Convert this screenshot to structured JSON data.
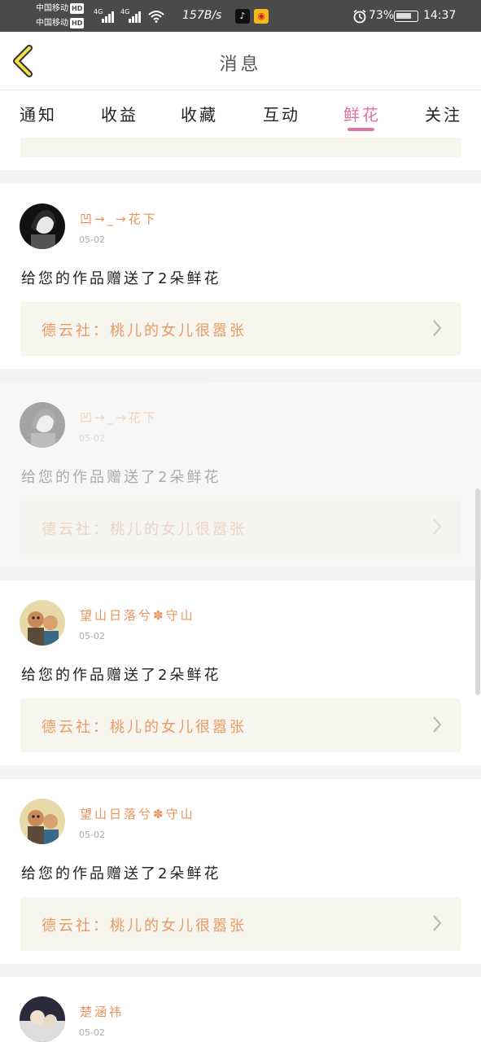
{
  "status_bar": {
    "carrier1": "中国移动",
    "carrier2": "中国移动",
    "hd": "HD",
    "net1": "4G",
    "net2": "4G",
    "speed": "157B/s",
    "battery": "73%",
    "time": "14:37"
  },
  "header": {
    "title": "消息"
  },
  "tabs": [
    {
      "label": "通知"
    },
    {
      "label": "收益"
    },
    {
      "label": "收藏"
    },
    {
      "label": "互动"
    },
    {
      "label": "鲜花"
    },
    {
      "label": "关注"
    }
  ],
  "active_tab": "鲜花",
  "items": [
    {
      "user": "凹→_→花下",
      "date": "05-02",
      "message": "给您的作品赠送了2朵鲜花",
      "work": "德云社：桃儿的女儿很嚣张"
    },
    {
      "user": "凹→_→花下",
      "date": "05-02",
      "message": "给您的作品赠送了2朵鲜花",
      "work": "德云社：桃儿的女儿很嚣张"
    },
    {
      "user": "望山日落兮✽守山",
      "date": "05-02",
      "message": "给您的作品赠送了2朵鲜花",
      "work": "德云社：桃儿的女儿很嚣张"
    },
    {
      "user": "望山日落兮✽守山",
      "date": "05-02",
      "message": "给您的作品赠送了2朵鲜花",
      "work": "德云社：桃儿的女儿很嚣张"
    },
    {
      "user": "楚涵祎",
      "date": "05-02"
    }
  ],
  "colors": {
    "accent": "#e072a4",
    "username": "#e8945a",
    "work_title": "#e89a64",
    "work_bg": "#f6f5ee"
  }
}
